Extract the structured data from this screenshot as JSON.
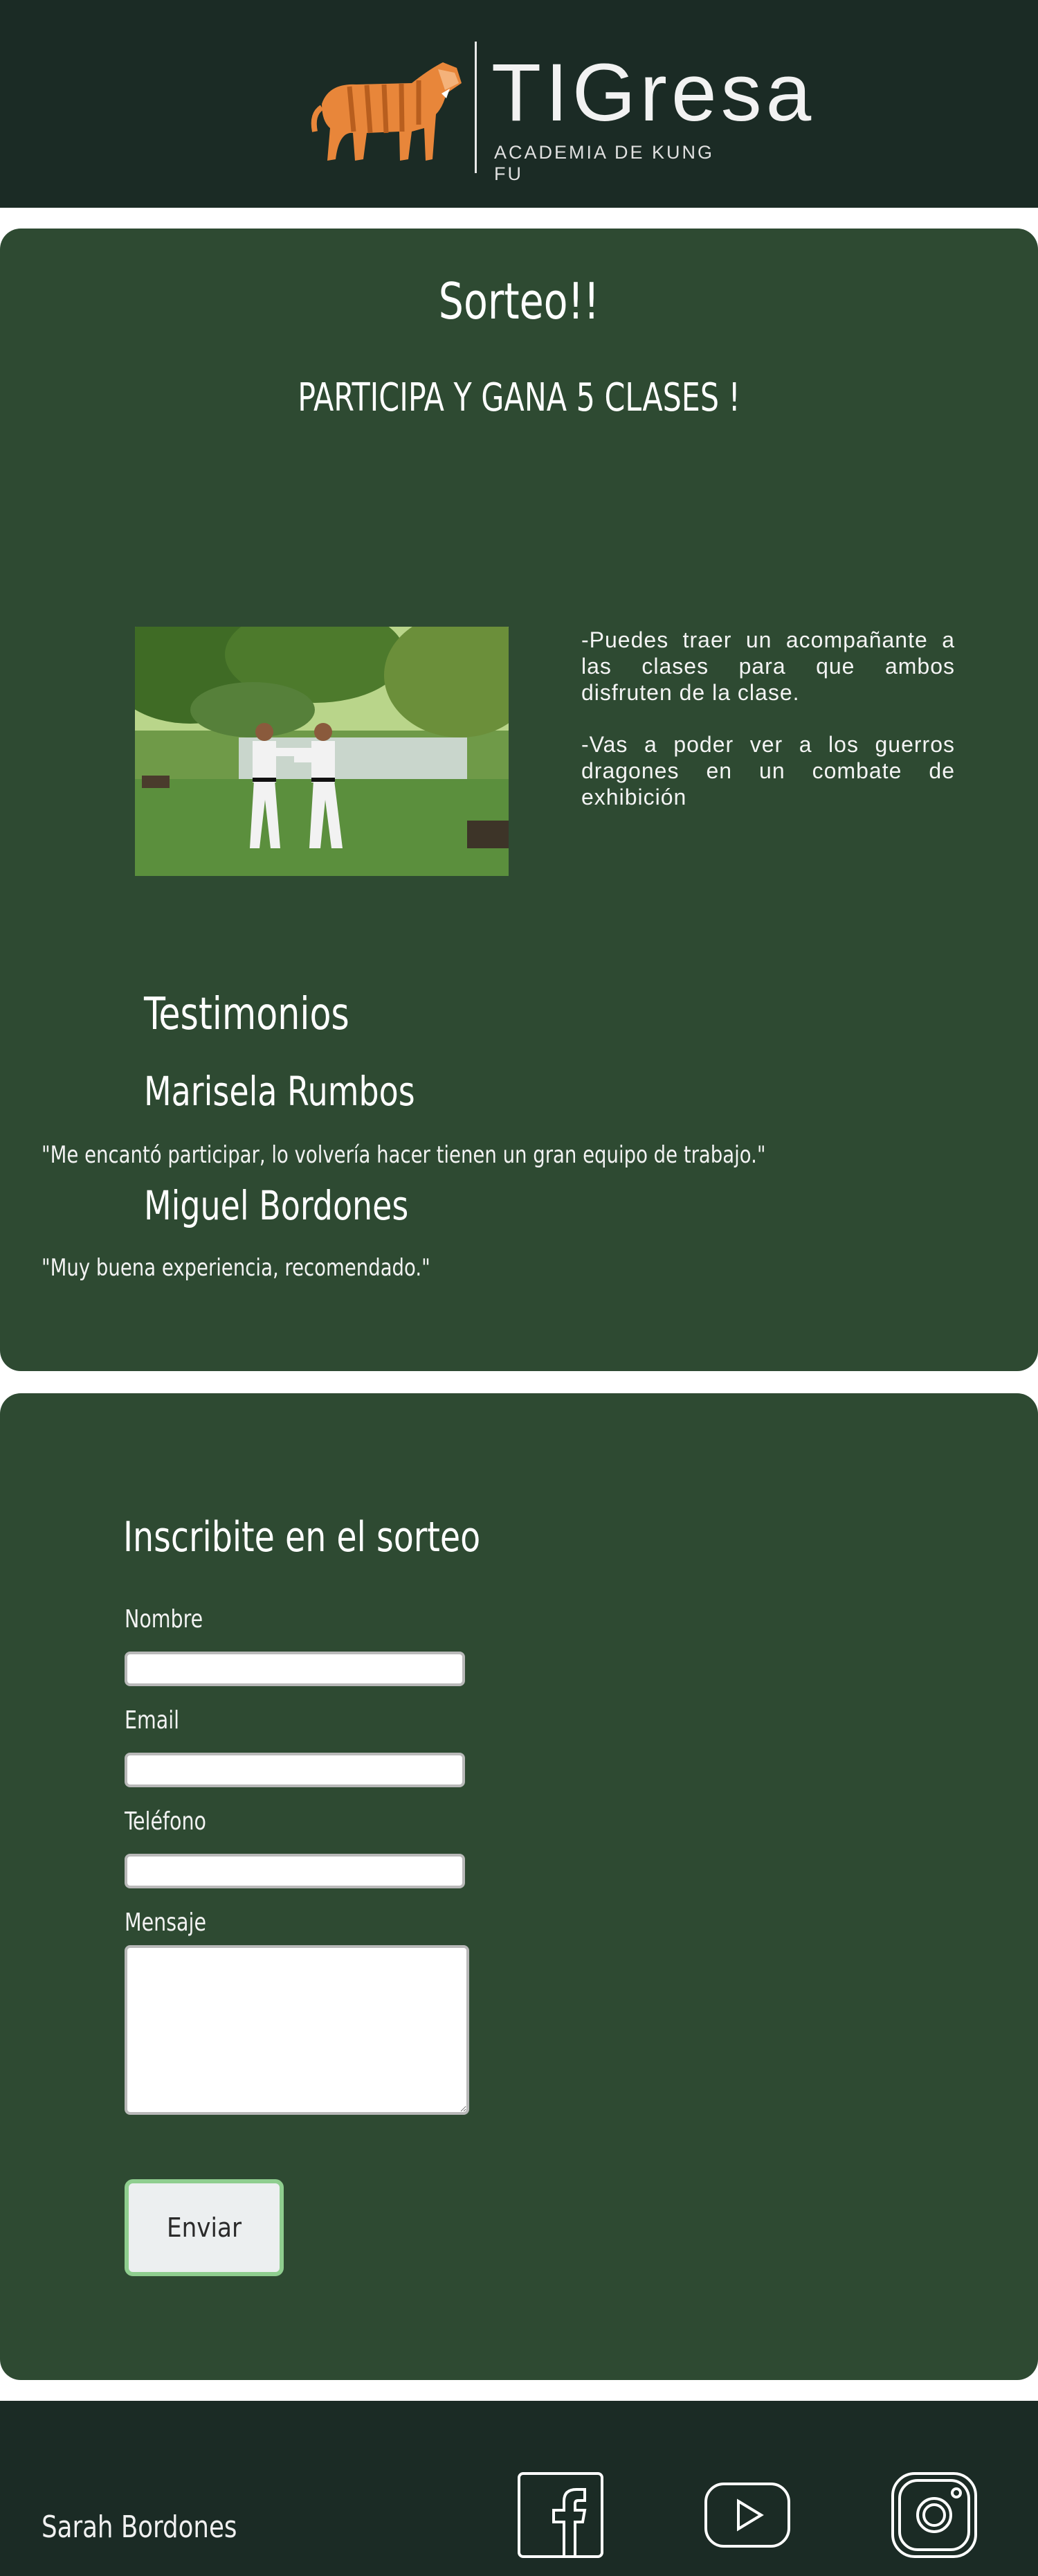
{
  "brand": {
    "name": "TIGresa",
    "tagline": "ACADEMIA DE KUNG FU"
  },
  "promo": {
    "title": "Sorteo!!",
    "subtitle": "PARTICIPA Y GANA 5 CLASES !",
    "perks": [
      "-Puedes traer un acompañante a las clases para que ambos disfruten de la clase.",
      "-Vas a poder ver a los guerros dragones en un combate de exhibición"
    ]
  },
  "testimonials": {
    "heading": "Testimonios",
    "items": [
      {
        "name": "Marisela Rumbos",
        "quote": "\"Me encantó participar, lo volvería hacer tienen un gran equipo de trabajo.\""
      },
      {
        "name": "Miguel Bordones",
        "quote": "\"Muy buena experiencia, recomendado.\""
      }
    ]
  },
  "form": {
    "title": "Inscribite en el sorteo",
    "fields": [
      {
        "label": "Nombre",
        "value": ""
      },
      {
        "label": "Email",
        "value": ""
      },
      {
        "label": "Teléfono",
        "value": ""
      },
      {
        "label": "Mensaje",
        "value": ""
      }
    ],
    "submit_label": "Enviar"
  },
  "footer": {
    "author": "Sarah Bordones",
    "social": [
      {
        "icon": "facebook-icon"
      },
      {
        "icon": "youtube-icon"
      },
      {
        "icon": "instagram-icon"
      }
    ]
  },
  "colors": {
    "header_bg": "#1b2b25",
    "panel_bg": "#2e4a32",
    "button_border": "#8fce8f",
    "tiger_orange": "#e8863a"
  }
}
